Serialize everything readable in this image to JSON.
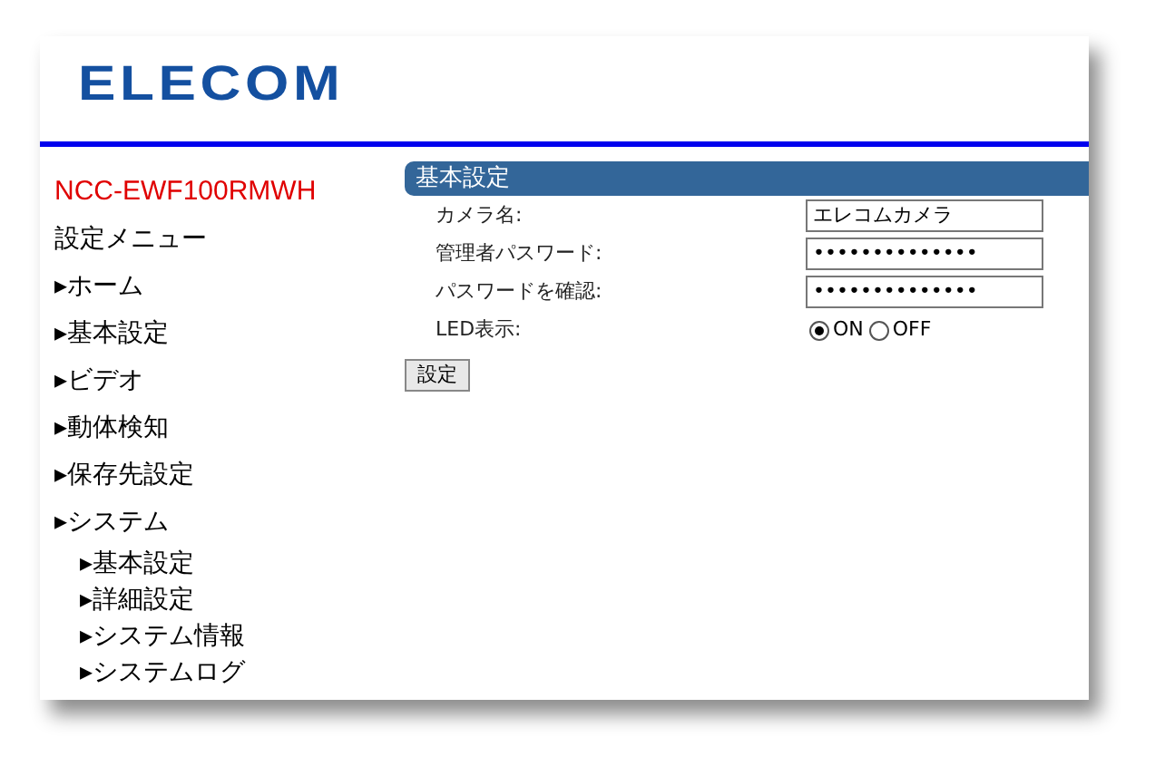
{
  "logo": "ELECOM",
  "sidebar": {
    "model": "NCC-EWF100RMWH",
    "menu_title": "設定メニュー",
    "items": [
      {
        "label": "▸ホーム"
      },
      {
        "label": "▸基本設定"
      },
      {
        "label": "▸ビデオ"
      },
      {
        "label": "▸動体検知"
      },
      {
        "label": "▸保存先設定"
      },
      {
        "label": "▸システム",
        "children": [
          {
            "label": "▸基本設定"
          },
          {
            "label": "▸詳細設定"
          },
          {
            "label": "▸システム情報"
          },
          {
            "label": "▸システムログ"
          }
        ]
      }
    ]
  },
  "section": {
    "title": "基本設定",
    "fields": [
      {
        "kind": "text",
        "label": "カメラ名:",
        "value": "エレコムカメラ"
      },
      {
        "kind": "text",
        "label": "管理者パスワード:",
        "value": "••••••••••••••"
      },
      {
        "kind": "text",
        "label": "パスワードを確認:",
        "value": "••••••••••••••"
      },
      {
        "kind": "radio",
        "label": "LED表示:",
        "options": [
          {
            "label": "ON",
            "selected": true
          },
          {
            "label": "OFF",
            "selected": false
          }
        ]
      }
    ],
    "button": "設定"
  }
}
